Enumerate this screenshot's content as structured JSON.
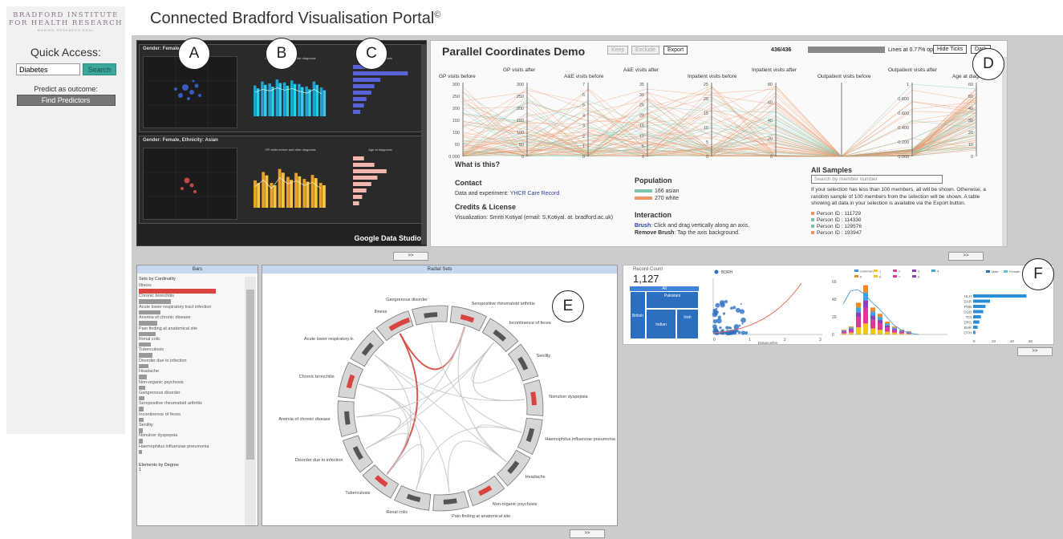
{
  "logo": {
    "line1": "BRADFORD INSTITUTE",
    "line2": "FOR HEALTH RESEARCH",
    "line3": "MAKING RESEARCH REAL"
  },
  "header": {
    "title": "Connected Bradford Visualisation Portal",
    "mark": "©"
  },
  "sidebar": {
    "quick_access": "Quick Access:",
    "search_value": "Diabetes",
    "search_button": "Search",
    "predict_label": "Predict as outcome:",
    "find_predictors": "Find Predictors"
  },
  "labels": {
    "a": "A",
    "b": "B",
    "c": "C",
    "d": "D",
    "e": "E",
    "f": "F"
  },
  "dashboard": {
    "top_label": "Gender: Female",
    "bottom_label": "Gender: Female, Ethnicity: Asian",
    "sub_gp": "GP visits before and after diagnosis",
    "sub_age": "Age at diagnosis",
    "watermark": "Google Data Studio",
    "top_bar_heights": [
      0.62,
      0.7,
      0.66,
      0.74,
      0.68,
      0.72,
      0.65,
      0.6,
      0.7,
      0.58
    ],
    "bottom_bar_heights": [
      0.55,
      0.72,
      0.5,
      0.78,
      0.62,
      0.7,
      0.58,
      0.66,
      0.5
    ],
    "top_hbar_widths": [
      0.25,
      0.9,
      0.45,
      0.35,
      0.3,
      0.22,
      0.18,
      0.12
    ],
    "bottom_hbar_widths": [
      0.18,
      0.35,
      0.55,
      0.4,
      0.3,
      0.22,
      0.15,
      0.1
    ]
  },
  "parallel": {
    "title": "Parallel Coordinates Demo",
    "keep": "Keep",
    "exclude": "Exclude",
    "export": "Export",
    "count": "436/436",
    "opacity_text": "Lines at 0.77% opacity.",
    "hide_ticks": "Hide Ticks",
    "dark": "Dark",
    "axes": [
      {
        "label": "GP visits before",
        "ticks": [
          "300",
          "250",
          "200",
          "150",
          "100",
          "50",
          "0.000"
        ]
      },
      {
        "label": "GP visits after",
        "ticks": [
          "300",
          "250",
          "200",
          "150",
          "100",
          "50",
          "0"
        ]
      },
      {
        "label": "A&E visits before",
        "ticks": [
          "7",
          "6",
          "5",
          "4",
          "3",
          "2",
          "1",
          "0"
        ]
      },
      {
        "label": "A&E visits after",
        "ticks": [
          "35",
          "30",
          "25",
          "20",
          "15",
          "10",
          "5",
          "0"
        ]
      },
      {
        "label": "Inpatient visits before",
        "ticks": [
          "25",
          "20",
          "15",
          "10",
          "5",
          "0"
        ]
      },
      {
        "label": "Inpatient visits after",
        "ticks": [
          "80",
          "60",
          "40",
          "20",
          "0"
        ]
      },
      {
        "label": "Outpatient visits before",
        "ticks": []
      },
      {
        "label": "Outpatient visits after",
        "ticks": [
          "1",
          "0.800",
          "0.600",
          "0.400",
          "0.200",
          "0.000"
        ]
      },
      {
        "label": "Age at diagnosis",
        "ticks": [
          "60",
          "50",
          "40",
          "30",
          "20",
          "10",
          "0"
        ]
      }
    ],
    "what_is_this": "What is this?",
    "contact_h": "Contact",
    "contact_text": "Data and experiment:",
    "contact_link": "YHCR Care Record",
    "credits_h": "Credits & License",
    "credits_text": "Visualization: Smriti Kotiyal (email: S.Kotiyal. at. bradford.ac.uk)",
    "population_h": "Population",
    "pop_asian": "166 asian",
    "pop_white": "270 white",
    "interaction_h": "Interaction",
    "brush_b": "Brush",
    "brush_t": ": Click and drag vertically along an axis.",
    "remove_b": "Remove Brush",
    "remove_t": ": Tap the axis background.",
    "samples_h": "All Samples",
    "samples_placeholder": "Search by member number",
    "samples_text": "If your selection has less than 100 members, all will be shown. Otherwise, a random sample of 100 members from the selection will be shown. A table showing all data in your selection is available via the Export button.",
    "persons": [
      "Person ID : 111729",
      "Person ID : 114330",
      "Person ID : 129576",
      "Person ID : 193947"
    ],
    "colors": {
      "asian": "#7ec4a8",
      "white": "#ef9466"
    }
  },
  "more_label": ">>",
  "sets": {
    "header": "Bars",
    "section": "Sets by Cardinality",
    "items": [
      {
        "label": "Illness",
        "value": 1.0,
        "hl": true
      },
      {
        "label": "Chronic bronchitis",
        "value": 0.42,
        "hl": false
      },
      {
        "label": "Acute lower respiratory tract infection",
        "value": 0.28,
        "hl": false
      },
      {
        "label": "Anemia of chronic disease",
        "value": 0.24,
        "hl": false
      },
      {
        "label": "Pain finding at anatomical site",
        "value": 0.22,
        "hl": false
      },
      {
        "label": "Renal colic",
        "value": 0.16,
        "hl": false
      },
      {
        "label": "Tuberculosis",
        "value": 0.18,
        "hl": false
      },
      {
        "label": "Disorder due to infection",
        "value": 0.12,
        "hl": false
      },
      {
        "label": "Headache",
        "value": 0.1,
        "hl": false
      },
      {
        "label": "Non-organic psychosis",
        "value": 0.08,
        "hl": false
      },
      {
        "label": "Gangrenous disorder",
        "value": 0.07,
        "hl": false
      },
      {
        "label": "Seropositive rheumatoid arthritis",
        "value": 0.06,
        "hl": false
      },
      {
        "label": "Incontinence of feces",
        "value": 0.06,
        "hl": false
      },
      {
        "label": "Senility",
        "value": 0.05,
        "hl": false
      },
      {
        "label": "Nonulcer dyspepsia",
        "value": 0.05,
        "hl": false
      },
      {
        "label": "Haemophilus influenzae pneumonia",
        "value": 0.04,
        "hl": false
      }
    ],
    "degree_label": "Elements by Degree",
    "degree_value": "1"
  },
  "radial": {
    "header": "Radial Sets",
    "labels": [
      "Gangrenous disorder",
      "Seropositive rheumatoid arthritis",
      "Incontinence of feces",
      "Senility",
      "Nonulcer dyspepsia",
      "Haemophilus influenzae pneumonia",
      "Headache",
      "Non-organic psychosis",
      "Pain finding at anatomical site",
      "Renal colic",
      "Tuberculosis",
      "Disorder due to infection",
      "Anemia of chronic disease",
      "Chronic bronchitis",
      "Acute lower respiratory tr.",
      "Illness"
    ]
  },
  "fpanel": {
    "record_label": "Record Count",
    "record_value": "1,127",
    "tree_all": "All",
    "tree_pakistani": "Pakistani",
    "tree_british": "British",
    "tree_indian": "Indian",
    "tree_irish": "Irish",
    "scatter_legend": "BDRH",
    "scatter_xlabel": "Distance/km",
    "scatter_ylabel": "Distance",
    "scatter_x_ticks": [
      "0",
      "1",
      "2",
      "3"
    ],
    "scatter_y_ticks": [
      "0",
      "20",
      "40"
    ],
    "stack_y_ticks": [
      "0",
      "20",
      "40",
      "60"
    ],
    "stack_legend": [
      "Unknown",
      "1",
      "2",
      "3",
      "4",
      "5",
      "6",
      "7",
      "8"
    ],
    "stack_x_ticks": [
      "2003-2004",
      "2005-2006",
      "2007-2008",
      "2009-2010",
      "2011-2012",
      "2013-2014",
      "2015-2016",
      "2017-2018"
    ],
    "hbar_legend_a": "Male",
    "hbar_legend_b": "Female",
    "hbar_cats": [
      "HLH",
      "DAR",
      "PSB",
      "DGB",
      "TOI",
      "DRS",
      "BHK",
      "OTH"
    ],
    "hbar_values": [
      0.95,
      0.3,
      0.22,
      0.18,
      0.14,
      0.11,
      0.08,
      0.04
    ],
    "hbar_x_ticks": [
      "0",
      "20",
      "40",
      "60"
    ]
  }
}
